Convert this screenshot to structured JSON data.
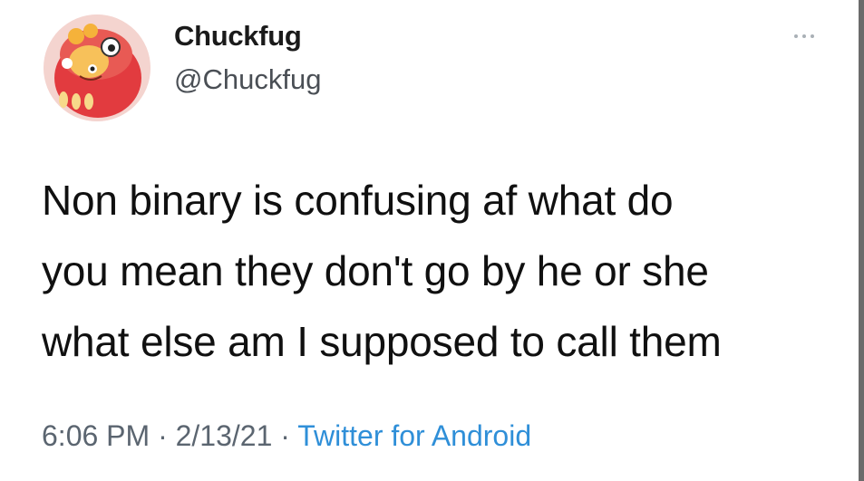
{
  "user": {
    "display_name": "Chuckfug",
    "handle": "@Chuckfug",
    "avatar_icon": "avatar-icon"
  },
  "menu": {
    "icon": "more-icon"
  },
  "tweet": {
    "lines": [
      "Non binary is confusing af what do",
      "you mean they don't go by he or she",
      "what else am I supposed to call them"
    ]
  },
  "meta": {
    "time": "6:06 PM",
    "separator": "·",
    "date": "2/13/21",
    "source": "Twitter for Android"
  },
  "colors": {
    "text": "#101010",
    "muted": "#5b6570",
    "link": "#2f8fd8",
    "avatar_red": "#e23b3f"
  }
}
